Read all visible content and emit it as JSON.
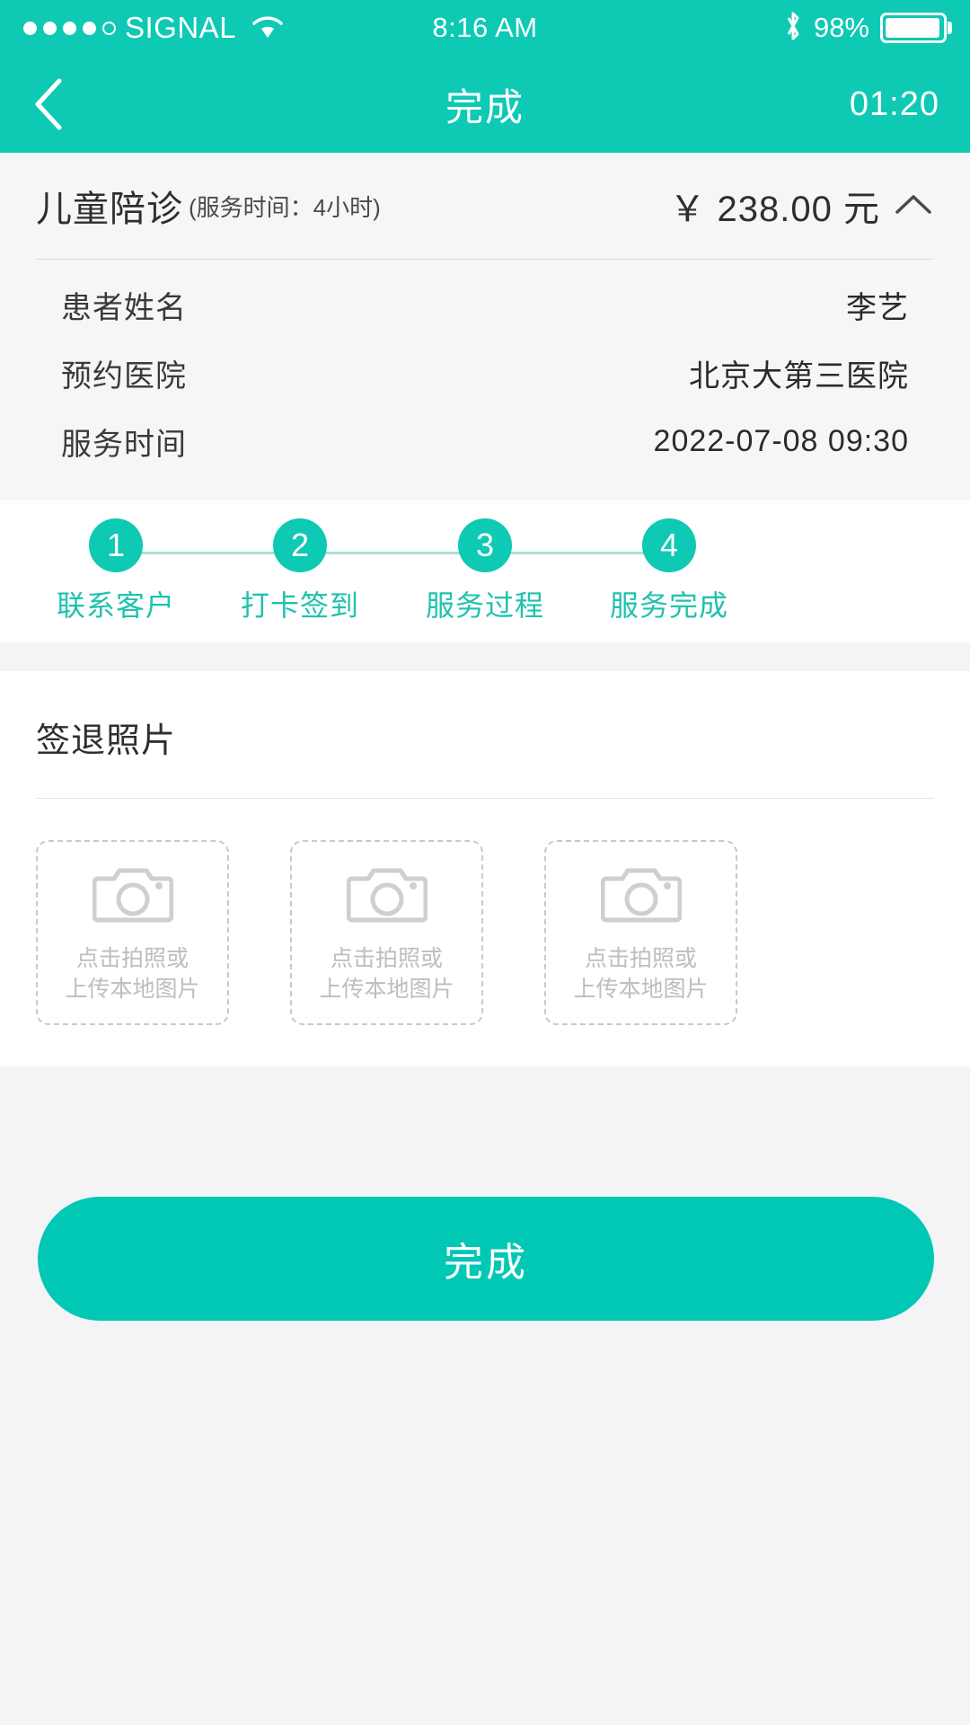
{
  "statusbar": {
    "carrier": "SIGNAL",
    "time": "8:16 AM",
    "battery": "98%",
    "signal_dots_filled": 4,
    "signal_dots_total": 5,
    "wifi_icon": "wifi-icon",
    "bluetooth_icon": "bluetooth-icon",
    "battery_icon": "battery-icon"
  },
  "navbar": {
    "back_icon": "chevron-left-icon",
    "title": "完成",
    "timer": "01:20"
  },
  "order": {
    "service_name": "儿童陪诊",
    "service_sub": "(服务时间：4小时)",
    "price": "￥ 238.00 元",
    "collapse_icon": "chevron-up-icon",
    "rows": [
      {
        "label": "患者姓名",
        "value": "李艺"
      },
      {
        "label": "预约医院",
        "value": "北京大第三医院"
      },
      {
        "label": "服务时间",
        "value": "2022-07-08 09:30"
      }
    ]
  },
  "stepper": {
    "steps": [
      {
        "num": "1",
        "label": "联系客户"
      },
      {
        "num": "2",
        "label": "打卡签到"
      },
      {
        "num": "3",
        "label": "服务过程"
      },
      {
        "num": "4",
        "label": "服务完成"
      }
    ]
  },
  "photos": {
    "title": "签退照片",
    "slots": [
      {
        "line1": "点击拍照或",
        "line2": "上传本地图片",
        "icon": "camera-icon"
      },
      {
        "line1": "点击拍照或",
        "line2": "上传本地图片",
        "icon": "camera-icon"
      },
      {
        "line1": "点击拍照或",
        "line2": "上传本地图片",
        "icon": "camera-icon"
      }
    ]
  },
  "footer": {
    "submit_label": "完成"
  },
  "colors": {
    "accent": "#0ec9b4",
    "accent_button": "#00c8b4",
    "step_line": "#a8ded6",
    "step_label": "#1fc2ae",
    "page_bg": "#f4f4f6",
    "card_bg": "#ffffff",
    "info_bg": "#f6f6f8",
    "placeholder_text": "#bdbdc2"
  }
}
